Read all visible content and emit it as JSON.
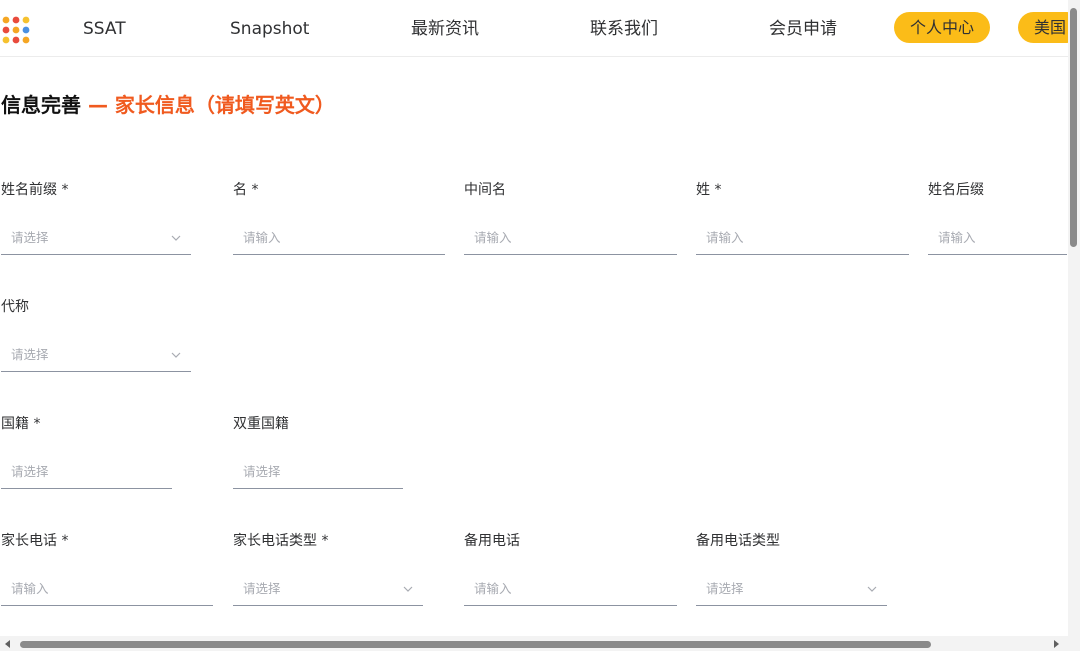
{
  "header": {
    "nav": [
      "SSAT",
      "Snapshot",
      "最新资讯",
      "联系我们",
      "会员申请"
    ],
    "personal_center": "个人中心",
    "region": "美国",
    "accent_color": "#fbbc18",
    "logo_dot_colors": [
      "#f5a623",
      "#e94b3c",
      "#f6c12e",
      "#e94b3c",
      "#f5a623",
      "#4a90e2",
      "#f6c12e",
      "#e94b3c",
      "#f5a623"
    ]
  },
  "page": {
    "title_main": "信息完善",
    "title_sub": " — 家长信息（请填写英文）",
    "title_sub_color": "#f05a1f"
  },
  "form": {
    "name_prefix": {
      "label": "姓名前缀 *",
      "placeholder": "请选择"
    },
    "first_name": {
      "label": "名 *",
      "placeholder": "请输入"
    },
    "middle_name": {
      "label": "中间名",
      "placeholder": "请输入"
    },
    "last_name": {
      "label": "姓 *",
      "placeholder": "请输入"
    },
    "name_suffix": {
      "label": "姓名后缀",
      "placeholder": "请输入"
    },
    "pronoun": {
      "label": "代称",
      "placeholder": "请选择"
    },
    "nationality": {
      "label": "国籍 *",
      "placeholder": "请选择"
    },
    "dual_nationality": {
      "label": "双重国籍",
      "placeholder": "请选择"
    },
    "parent_phone": {
      "label": "家长电话 *",
      "placeholder": "请输入"
    },
    "parent_phone_type": {
      "label": "家长电话类型 *",
      "placeholder": "请选择"
    },
    "backup_phone": {
      "label": "备用电话",
      "placeholder": "请输入"
    },
    "backup_phone_type": {
      "label": "备用电话类型",
      "placeholder": "请选择"
    }
  }
}
